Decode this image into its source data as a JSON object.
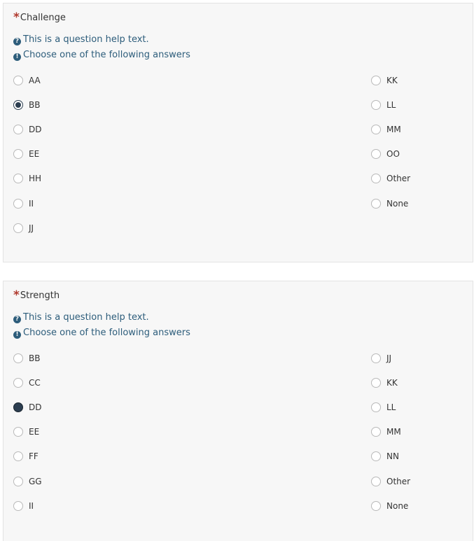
{
  "questions": [
    {
      "title": "Challenge",
      "required_mark": "*",
      "help_text": "This is a question help text.",
      "instruction": "Choose one of the following answers",
      "help_icon": "question-circle-icon",
      "instruction_icon": "exclamation-circle-icon",
      "left_options": [
        "AA",
        "BB",
        "DD",
        "EE",
        "HH",
        "II",
        "JJ"
      ],
      "right_options": [
        "KK",
        "LL",
        "MM",
        "OO",
        "Other",
        "None"
      ],
      "selected": "BB"
    },
    {
      "title": "Strength",
      "required_mark": "*",
      "help_text": "This is a question help text.",
      "instruction": "Choose one of the following answers",
      "help_icon": "question-circle-icon",
      "instruction_icon": "exclamation-circle-icon",
      "left_options": [
        "BB",
        "CC",
        "DD",
        "EE",
        "FF",
        "GG",
        "II"
      ],
      "right_options": [
        "JJ",
        "KK",
        "LL",
        "MM",
        "NN",
        "Other",
        "None"
      ],
      "selected": "DD"
    }
  ],
  "colors": {
    "required": "#b03a2e",
    "help_text": "#2d5d7b",
    "panel_bg": "#f7f7f7",
    "radio_checked": "#2c3e50"
  }
}
